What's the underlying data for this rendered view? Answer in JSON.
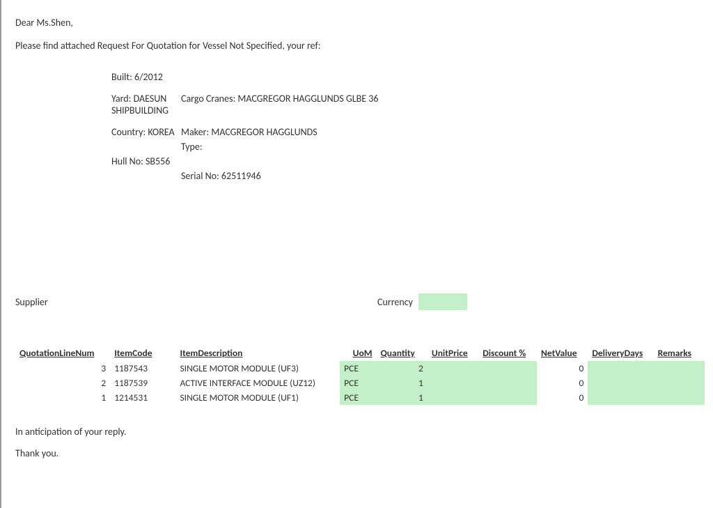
{
  "greeting": "Dear Ms.Shen,",
  "intro": "Please find attached Request For Quotation for Vessel Not Specified, your ref:",
  "details": {
    "built_label": "Built: 6/2012",
    "yard_label": "Yard: DAESUN SHIPBUILDING",
    "cargo_label": "Cargo Cranes: MACGREGOR HAGGLUNDS GLBE 36",
    "country_label": "Country: KOREA",
    "maker_label": "Maker: MACGREGOR HAGGLUNDS",
    "type_label": "Type:",
    "hullno_label": "Hull No: SB556",
    "serial_label": "Serial No: 62511946"
  },
  "supplier_label": "Supplier",
  "currency_label": "Currency",
  "currency_value": "",
  "table": {
    "headers": {
      "linenum": "QuotationLineNum",
      "itemcode": "ItemCode",
      "desc": "ItemDescription",
      "uom": "UoM",
      "qty": "Quantity",
      "unitprice": "UnitPrice",
      "discount": "Discount %",
      "netvalue": "NetValue",
      "deliverydays": "DeliveryDays",
      "remarks": "Remarks"
    },
    "rows": [
      {
        "linenum": "3",
        "itemcode": "1187543",
        "desc": "SINGLE MOTOR MODULE (UF3)",
        "uom": "PCE",
        "qty": "2",
        "unitprice": "",
        "discount": "",
        "netvalue": "0",
        "deliverydays": "",
        "remarks": ""
      },
      {
        "linenum": "2",
        "itemcode": "1187539",
        "desc": "ACTIVE INTERFACE MODULE (UZ12)",
        "uom": "PCE",
        "qty": "1",
        "unitprice": "",
        "discount": "",
        "netvalue": "0",
        "deliverydays": "",
        "remarks": ""
      },
      {
        "linenum": "1",
        "itemcode": "1214531",
        "desc": "SINGLE MOTOR MODULE (UF1)",
        "uom": "PCE",
        "qty": "1",
        "unitprice": "",
        "discount": "",
        "netvalue": "0",
        "deliverydays": "",
        "remarks": ""
      }
    ]
  },
  "closing1": "In anticipation of your reply.",
  "closing2": "Thank you."
}
